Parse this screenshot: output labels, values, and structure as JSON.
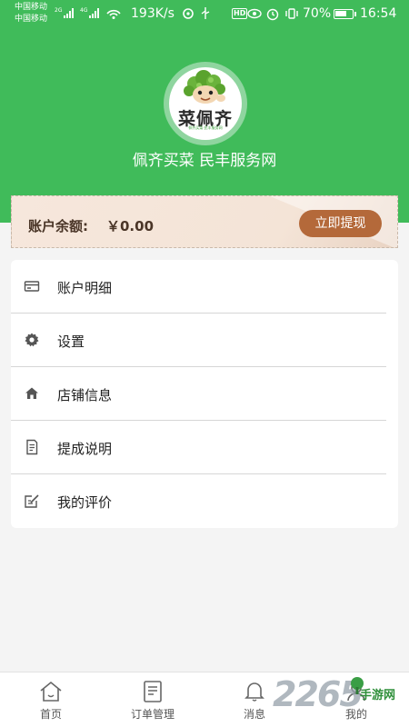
{
  "status_bar": {
    "carrier_1": "中国移动",
    "carrier_2": "中国移动",
    "network_1": "2G",
    "network_2": "4G",
    "speed": "193K/s",
    "battery": "70%",
    "battery_level": 0.7,
    "time": "16:54",
    "hd": "HD"
  },
  "header": {
    "logo_text": "菜佩齐",
    "logo_subtitle": "佩齐买菜·民丰服务网",
    "store_name": "佩齐买菜 民丰服务网",
    "background_color": "#40bb5a"
  },
  "balance": {
    "label": "账户余额:",
    "value": "￥0.00",
    "withdraw_label": "立即提现",
    "button_color": "#b4693a"
  },
  "menu": {
    "items": [
      {
        "label": "账户明细",
        "icon": "card-icon"
      },
      {
        "label": "设置",
        "icon": "gear-icon"
      },
      {
        "label": "店铺信息",
        "icon": "home-icon"
      },
      {
        "label": "提成说明",
        "icon": "document-icon"
      },
      {
        "label": "我的评价",
        "icon": "edit-icon"
      }
    ]
  },
  "tabbar": {
    "items": [
      {
        "label": "首页",
        "icon": "home-tab-icon"
      },
      {
        "label": "订单管理",
        "icon": "order-icon"
      },
      {
        "label": "消息",
        "icon": "bell-icon"
      },
      {
        "label": "我的",
        "icon": "user-icon"
      }
    ]
  },
  "watermark": {
    "number": "2265",
    "site": "手游网"
  }
}
